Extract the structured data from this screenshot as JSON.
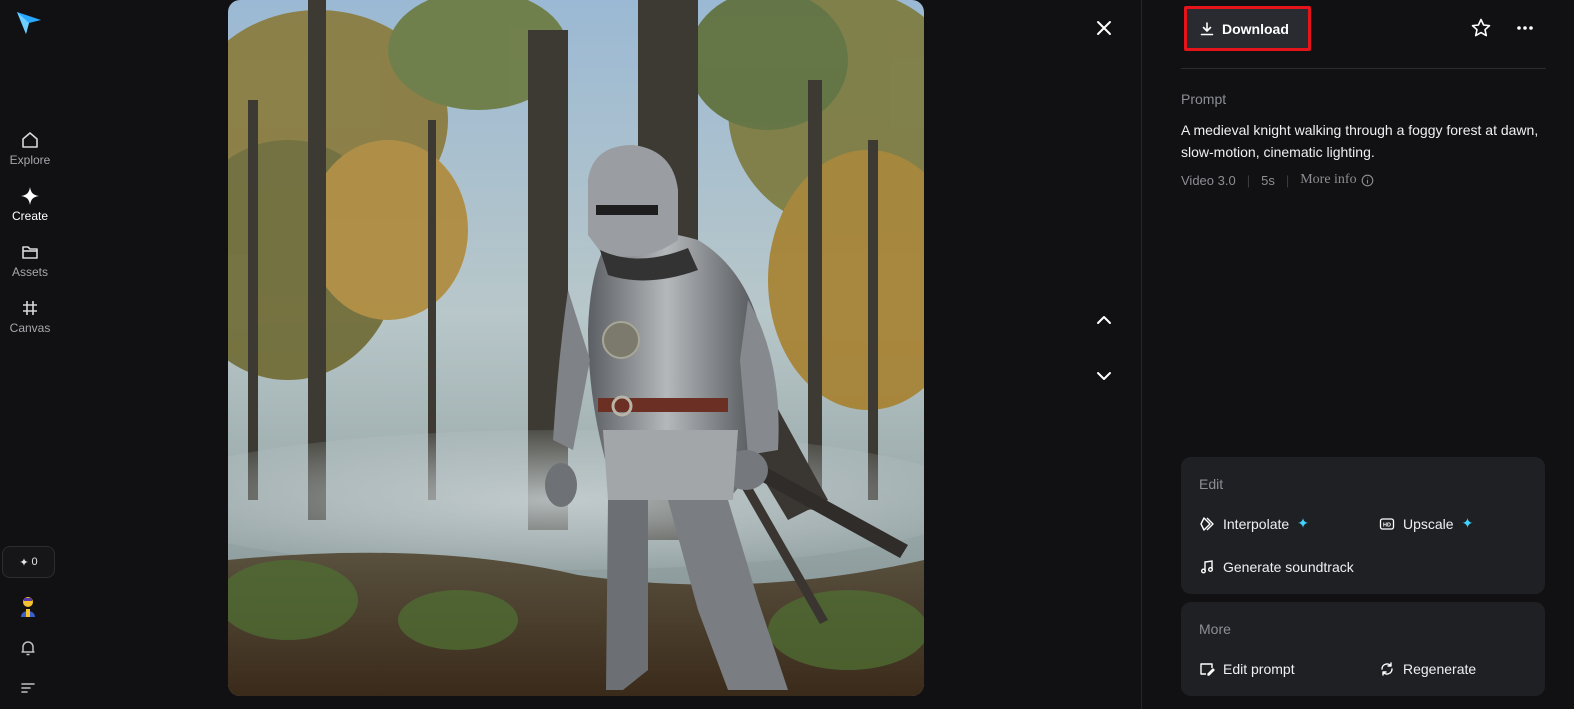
{
  "sidebar": {
    "logo_icon": "paper-plane-logo",
    "items": [
      {
        "label": "Explore",
        "icon": "home-icon"
      },
      {
        "label": "Create",
        "icon": "sparkle-icon",
        "active": true
      },
      {
        "label": "Assets",
        "icon": "folder-icon"
      },
      {
        "label": "Canvas",
        "icon": "grid-icon"
      }
    ],
    "credits": {
      "icon": "✦",
      "value": "0"
    },
    "avatar_icon": "avatar-icon",
    "bell_icon": "bell-icon",
    "menu_icon": "menu-icon"
  },
  "media": {
    "kind": "video-preview",
    "subject": "knight in armor in foggy autumn forest"
  },
  "viewer_controls": {
    "close_icon": "close-icon",
    "prev_icon": "chevron-up-icon",
    "next_icon": "chevron-down-icon"
  },
  "panel": {
    "download_label": "Download",
    "prompt_label": "Prompt",
    "prompt_text": "A medieval knight walking through a foggy forest at dawn, slow-motion, cinematic lighting.",
    "meta": {
      "model": "Video 3.0",
      "duration": "5s",
      "more_info": "More info"
    },
    "edit": {
      "title": "Edit",
      "interpolate": "Interpolate",
      "upscale": "Upscale",
      "soundtrack": "Generate soundtrack"
    },
    "more": {
      "title": "More",
      "edit_prompt": "Edit prompt",
      "regenerate": "Regenerate"
    }
  },
  "colors": {
    "background": "#111113",
    "card": "#1f2024",
    "accent_spark": "#3fd5ff",
    "highlight_border": "#e5141a"
  }
}
